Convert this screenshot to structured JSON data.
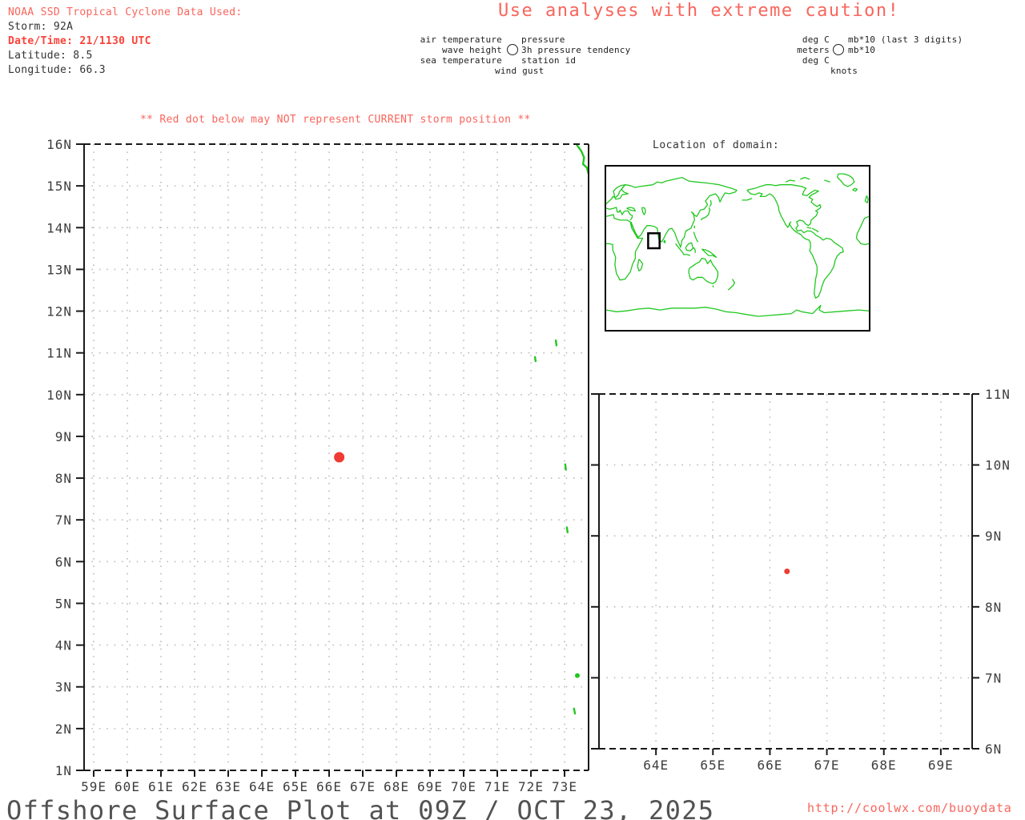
{
  "header": {
    "source_line": "NOAA SSD Tropical Cyclone Data Used:",
    "storm": "Storm: 92A",
    "datetime": "Date/Time: 21/1130 UTC",
    "latitude": "Latitude: 8.5",
    "longitude": "Longitude: 66.3"
  },
  "top_warning": "Use analyses with extreme caution!",
  "storm_note": "** Red dot below may NOT represent CURRENT storm position **",
  "station_legend": {
    "row1_left": "air temperature",
    "row1_right": "pressure",
    "row2_left": "wave height",
    "row2_right": "3h pressure tendency",
    "row3_left": "sea temperature",
    "row3_right": "station id",
    "row4": "wind gust"
  },
  "units_legend": {
    "row1_left": "deg C",
    "row1_right": "mb*10 (last 3 digits)",
    "row2_left": "meters",
    "row2_right": "mb*10",
    "row3_left": "deg C",
    "row4": "knots"
  },
  "inset": {
    "title": "Location of domain:",
    "domain_box": {
      "lon_min": 57.5,
      "lon_max": 73.2,
      "lat_min": 0,
      "lat_max": 16.5
    }
  },
  "footer": {
    "title": "Offshore Surface Plot at 09Z / OCT 23, 2025",
    "url": "http://coolwx.com/buoydata"
  },
  "colors": {
    "highlight_red": "#f9655c",
    "strong_red": "#fb4238",
    "dot_red": "#ee3b33",
    "coast_green": "#21c821",
    "grid_dot": "#bcbcbc",
    "axis_ink": "#1a1a1a",
    "label_gray": "#3d3d3d",
    "title_gray": "#525252"
  },
  "chart_data": [
    {
      "id": "main",
      "type": "scatter",
      "title": "",
      "xlabel": "",
      "ylabel": "",
      "grid": "dotted",
      "xlim": [
        58.714,
        73.714
      ],
      "ylim": [
        1,
        16
      ],
      "x_tick_values": [
        59,
        60,
        61,
        62,
        63,
        64,
        65,
        66,
        67,
        68,
        69,
        70,
        71,
        72,
        73
      ],
      "x_tick_labels": [
        "59E",
        "60E",
        "61E",
        "62E",
        "63E",
        "64E",
        "65E",
        "66E",
        "67E",
        "68E",
        "69E",
        "70E",
        "71E",
        "72E",
        "73E"
      ],
      "y_tick_values": [
        1,
        2,
        3,
        4,
        5,
        6,
        7,
        8,
        9,
        10,
        11,
        12,
        13,
        14,
        15,
        16
      ],
      "y_tick_labels": [
        "1N",
        "2N",
        "3N",
        "4N",
        "5N",
        "6N",
        "7N",
        "8N",
        "9N",
        "10N",
        "11N",
        "12N",
        "13N",
        "14N",
        "15N",
        "16N"
      ],
      "y_label_side": "left",
      "tick_sides": [
        "left",
        "bottom"
      ],
      "points": [
        {
          "name": "storm-92A-position",
          "lon": 66.3,
          "lat": 8.5,
          "radius": 6.5
        }
      ],
      "coast_fragments": [
        {
          "type": "line",
          "points": [
            [
              73.35,
              16.0
            ],
            [
              73.5,
              15.83
            ],
            [
              73.58,
              15.68
            ],
            [
              73.55,
              15.52
            ],
            [
              73.66,
              15.44
            ],
            [
              73.71,
              15.3
            ]
          ]
        },
        {
          "type": "line",
          "points": [
            [
              72.74,
              11.3
            ],
            [
              72.76,
              11.18
            ]
          ]
        },
        {
          "type": "line",
          "points": [
            [
              72.12,
              10.9
            ],
            [
              72.14,
              10.8
            ]
          ]
        },
        {
          "type": "line",
          "points": [
            [
              73.02,
              8.33
            ],
            [
              73.04,
              8.2
            ]
          ]
        },
        {
          "type": "line",
          "points": [
            [
              73.07,
              6.82
            ],
            [
              73.09,
              6.7
            ]
          ]
        },
        {
          "type": "dot",
          "points": [
            [
              73.38,
              3.27
            ]
          ]
        },
        {
          "type": "line",
          "points": [
            [
              73.28,
              2.48
            ],
            [
              73.31,
              2.36
            ]
          ]
        }
      ]
    },
    {
      "id": "zoom",
      "type": "scatter",
      "title": "",
      "xlabel": "",
      "ylabel": "",
      "grid": "dotted",
      "xlim": [
        63.0,
        69.55
      ],
      "ylim": [
        6,
        11
      ],
      "x_tick_values": [
        64,
        65,
        66,
        67,
        68,
        69
      ],
      "x_tick_labels": [
        "64E",
        "65E",
        "66E",
        "67E",
        "68E",
        "69E"
      ],
      "y_tick_values": [
        6,
        7,
        8,
        9,
        10,
        11
      ],
      "y_tick_labels": [
        "6N",
        "7N",
        "8N",
        "9N",
        "10N",
        "11N"
      ],
      "y_label_side": "right",
      "tick_sides": [
        "left",
        "right",
        "bottom"
      ],
      "points": [
        {
          "name": "storm-92A-position",
          "lon": 66.3,
          "lat": 8.5,
          "radius": 3.5
        }
      ],
      "coast_fragments": []
    }
  ]
}
